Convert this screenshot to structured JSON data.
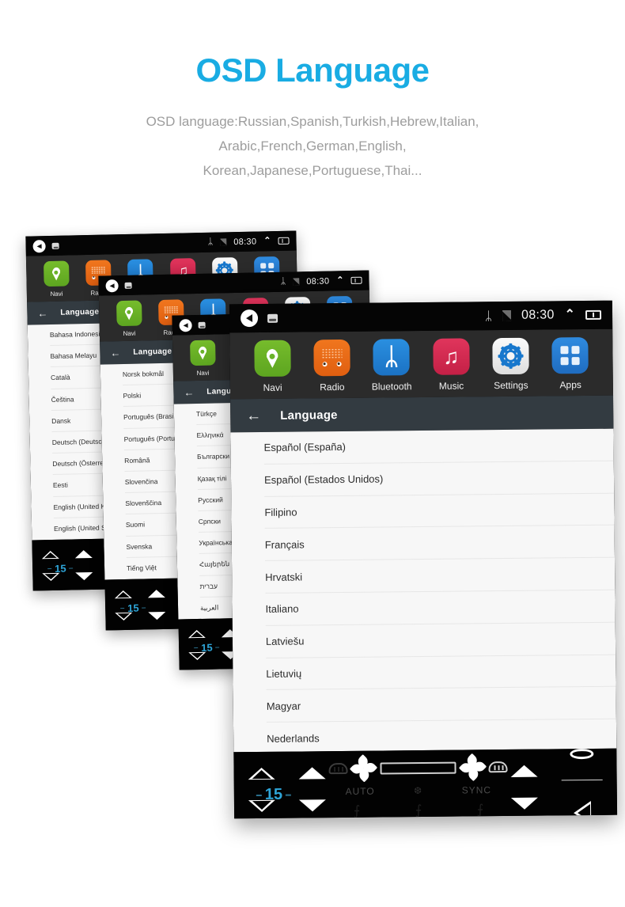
{
  "hero": {
    "title": "OSD Language",
    "subtitle_lines": [
      "OSD language:Russian,Spanish,Turkish,Hebrew,Italian,",
      "Arabic,French,German,English,",
      "Korean,Japanese,Portuguese,Thai..."
    ],
    "title_color": "#19ace3",
    "subtitle_color": "#9d9d9d"
  },
  "statusbar": {
    "back_icon": "volume-back-icon",
    "screenshot_icon": "screenshot-icon",
    "bluetooth_icon": "bluetooth-icon",
    "bluetooth_glyph": "ᛦ",
    "sim_icon": "sim-card-icon",
    "time": "08:30",
    "chevron_icon": "chevron-up-icon",
    "chevron_glyph": "⌃",
    "recents_icon": "recent-apps-icon"
  },
  "dock": {
    "items": [
      {
        "label": "Navi",
        "icon": "navi-pin-icon",
        "color": "#6ab32a"
      },
      {
        "label": "Radio",
        "icon": "radio-grille-icon",
        "color": "#e86a16"
      },
      {
        "label": "Bluetooth",
        "icon": "bluetooth-icon",
        "color": "#2180d4"
      },
      {
        "label": "Music",
        "icon": "music-note-icon",
        "color": "#d42a51"
      },
      {
        "label": "Settings",
        "icon": "gear-icon",
        "color": "#1878cd"
      },
      {
        "label": "Apps",
        "icon": "apps-grid-icon",
        "color": "#2878d0"
      }
    ]
  },
  "page_header": {
    "back_icon": "arrow-left-icon",
    "back_glyph": "←",
    "title": "Language"
  },
  "screens": [
    {
      "id": "screen-1",
      "languages": [
        "Bahasa Indonesia",
        "Bahasa Melayu",
        "Català",
        "Čeština",
        "Dansk",
        "Deutsch (Deutschland)",
        "Deutsch (Österreich)",
        "Eesti",
        "English (United Kingdom)",
        "English (United States)"
      ]
    },
    {
      "id": "screen-2",
      "languages": [
        "Norsk bokmål",
        "Polski",
        "Português (Brasil)",
        "Português (Portugal)",
        "Română",
        "Slovenčina",
        "Slovenščina",
        "Suomi",
        "Svenska",
        "Tiếng Việt"
      ]
    },
    {
      "id": "screen-3",
      "languages": [
        "Türkçe",
        "Ελληνικά",
        "Български",
        "Қазақ тілі",
        "Русский",
        "Српски",
        "Українська",
        "Հայերեն",
        "עברית",
        "العربية"
      ]
    },
    {
      "id": "screen-4",
      "languages": [
        "Español (España)",
        "Español (Estados Unidos)",
        "Filipino",
        "Français",
        "Hrvatski",
        "Italiano",
        "Latviešu",
        "Lietuvių",
        "Magyar",
        "Nederlands"
      ]
    }
  ],
  "climate": {
    "temperature": "15",
    "temperature_color": "#2ea5d8",
    "auto_label": "AUTO",
    "sync_label": "SYNC",
    "snowflake_glyph": "❆",
    "seat_glyph": "⨍",
    "temp_up_icon": "temp-up-icon",
    "temp_down_icon": "temp-down-icon",
    "fan_up_icon": "fan-up-icon",
    "fan_down_icon": "fan-down-icon",
    "defrost_front_icon": "defrost-front-icon",
    "defrost_rear_icon": "defrost-rear-icon",
    "fan_left_icon": "fan-left-icon",
    "fan_right_icon": "fan-right-icon",
    "slider_icon": "blower-slider-icon",
    "volume_up_icon": "volume-up-icon",
    "volume_down_icon": "volume-down-icon",
    "home_icon": "home-circle-icon",
    "back_icon": "back-triangle-icon"
  }
}
